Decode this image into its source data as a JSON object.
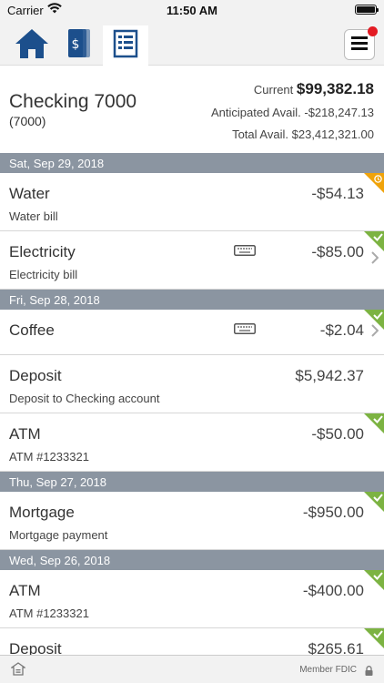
{
  "status": {
    "carrier": "Carrier",
    "time": "11:50 AM"
  },
  "nav": {
    "tabs": [
      {
        "icon": "home-icon"
      },
      {
        "icon": "money-cards-icon"
      },
      {
        "icon": "register-list-icon"
      }
    ],
    "menu_icon": "hamburger-menu-icon"
  },
  "account": {
    "name": "Checking 7000",
    "number": "(7000)",
    "current_label": "Current",
    "current_value": "$99,382.18",
    "anticipated_label": "Anticipated Avail.",
    "anticipated_value": "-$218,247.13",
    "total_label": "Total Avail.",
    "total_value": "$23,412,321.00"
  },
  "groups": [
    {
      "date": "Sat, Sep 29, 2018",
      "transactions": [
        {
          "title": "Water",
          "description": "Water bill",
          "amount": "-$54.13",
          "status": "pending"
        },
        {
          "title": "Electricity",
          "description": "Electricity bill",
          "amount": "-$85.00",
          "status": "cleared"
        }
      ]
    },
    {
      "date": "Fri, Sep 28, 2018",
      "transactions": [
        {
          "title": "Coffee",
          "description": "",
          "amount": "-$2.04",
          "status": "cleared"
        },
        {
          "title": "Deposit",
          "description": "Deposit to Checking account",
          "amount": "$5,942.37",
          "status": "none"
        },
        {
          "title": "ATM",
          "description": "ATM #1233321",
          "amount": "-$50.00",
          "status": "cleared"
        }
      ]
    },
    {
      "date": "Thu, Sep 27, 2018",
      "transactions": [
        {
          "title": "Mortgage",
          "description": "Mortgage payment",
          "amount": "-$950.00",
          "status": "cleared"
        }
      ]
    },
    {
      "date": "Wed, Sep 26, 2018",
      "transactions": [
        {
          "title": "ATM",
          "description": "ATM #1233321",
          "amount": "-$400.00",
          "status": "cleared"
        },
        {
          "title": "Deposit",
          "description": "",
          "amount": "$265.61",
          "status": "cleared"
        }
      ]
    }
  ],
  "footer": {
    "fdic": "Member FDIC"
  },
  "colors": {
    "cleared": "#7cb342",
    "pending": "#f0a30a",
    "header": "#8b95a1",
    "brand_blue": "#1c4f8c"
  }
}
